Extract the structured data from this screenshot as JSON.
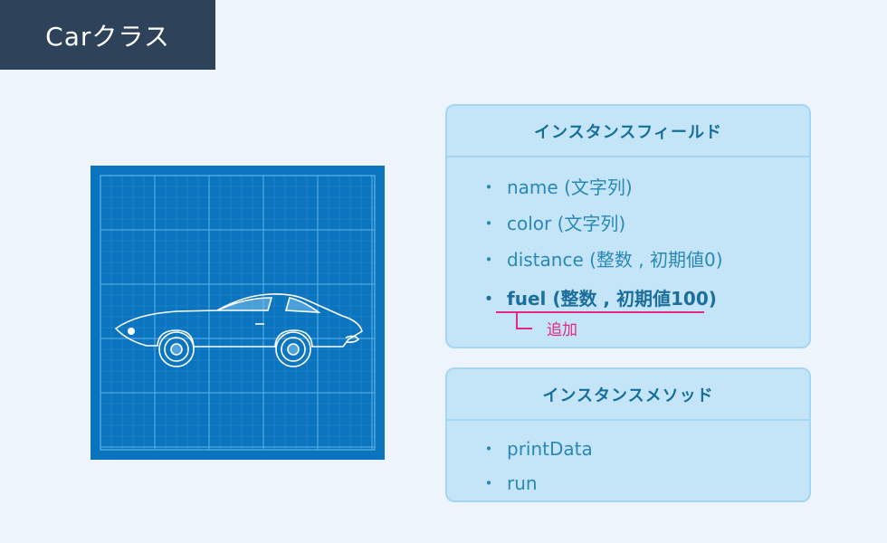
{
  "title": "Carクラス",
  "fields_panel": {
    "heading": "インスタンスフィールド",
    "items": [
      {
        "bullet": "・",
        "text": "name (文字列)"
      },
      {
        "bullet": "・",
        "text": "color (文字列)"
      },
      {
        "bullet": "・",
        "text": "distance (整数 , 初期値0)"
      },
      {
        "bullet": "・",
        "text": "fuel (整数 , 初期値100)"
      }
    ],
    "added_note": "追加"
  },
  "methods_panel": {
    "heading": "インスタンスメソッド",
    "items": [
      {
        "bullet": "・",
        "text": "printData"
      },
      {
        "bullet": "・",
        "text": "run"
      }
    ]
  },
  "colors": {
    "title_bg": "#2e4259",
    "blueprint_bg": "#0b74bf",
    "panel_bg": "#c4e4f7",
    "heading_text": "#166f99",
    "item_text": "#2b88b5",
    "accent": "#e3287f"
  }
}
